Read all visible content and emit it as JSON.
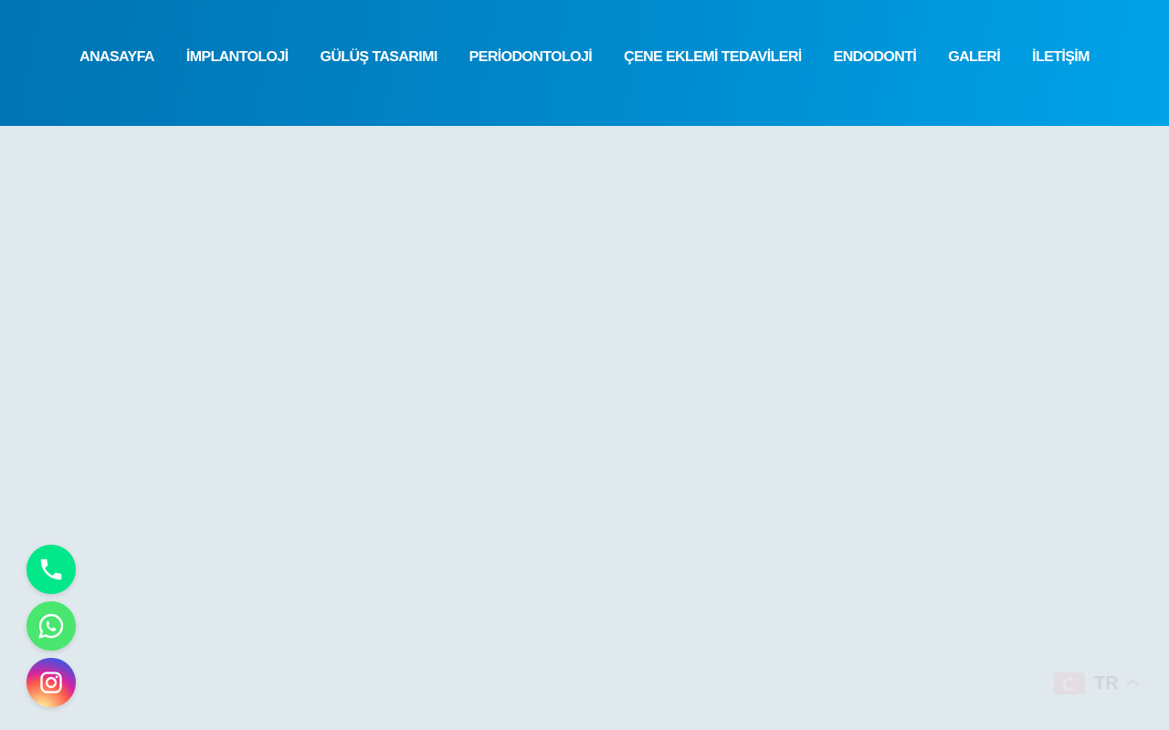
{
  "nav": {
    "items": [
      {
        "label": "ANASAYFA"
      },
      {
        "label": "İMPLANTOLOJİ"
      },
      {
        "label": "GÜLÜŞ TASARIMI"
      },
      {
        "label": "PERİODONTOLOJİ"
      },
      {
        "label": "ÇENE EKLEMİ TEDAVİLERİ"
      },
      {
        "label": "ENDODONTİ"
      },
      {
        "label": "GALERİ"
      },
      {
        "label": "İLETİŞİM"
      }
    ]
  },
  "floating_buttons": [
    {
      "icon": "phone-icon",
      "color": "#03e78b"
    },
    {
      "icon": "whatsapp-icon",
      "color": "#49e670"
    },
    {
      "icon": "instagram-icon",
      "color": "#d6249f"
    }
  ],
  "language": {
    "current": "TR",
    "flag_icon": "turkey-flag-icon"
  },
  "colors": {
    "header_start": "#0074b3",
    "header_end": "#00a2e8",
    "page_background": "#e0e9ed"
  }
}
